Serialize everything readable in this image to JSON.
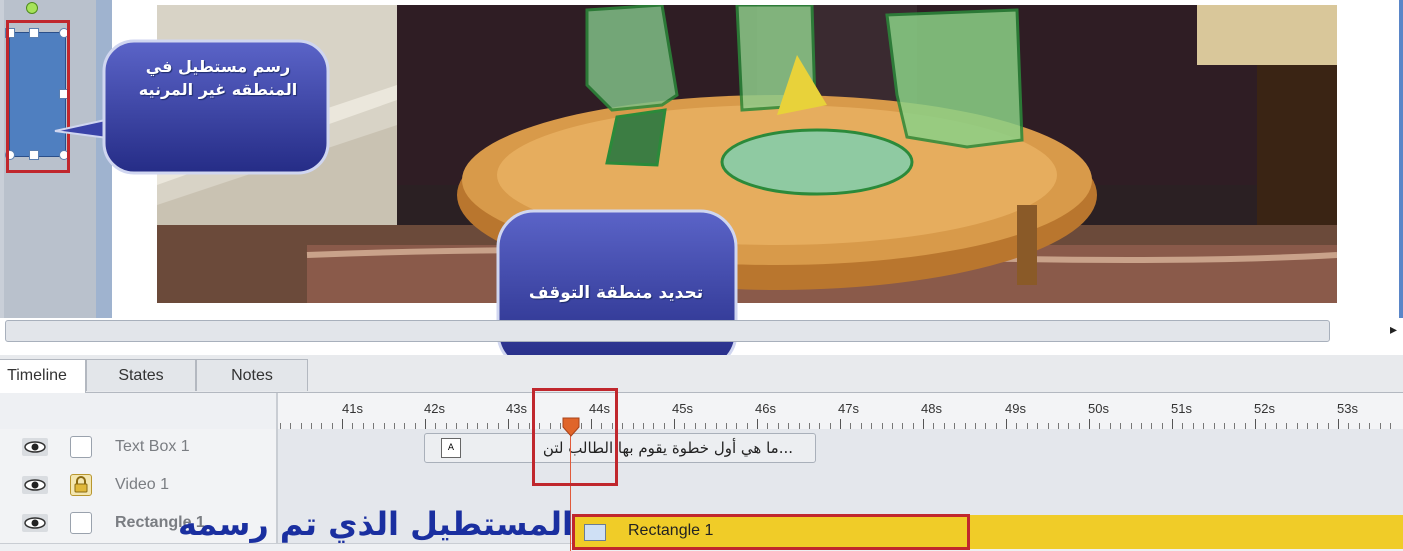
{
  "callouts": {
    "top": "رسم مستطيل في المنطقه غير المرنيه",
    "middle": "تحديد منطقة التوقف"
  },
  "caption": "المستطيل الذي تم رسمه",
  "tabs": [
    {
      "label": "Timeline",
      "active": true
    },
    {
      "label": "States",
      "active": false
    },
    {
      "label": "Notes",
      "active": false
    }
  ],
  "ruler": {
    "ticks": [
      "41s",
      "42s",
      "43s",
      "44s",
      "45s",
      "46s",
      "47s",
      "48s",
      "49s",
      "50s",
      "51s",
      "52s",
      "53s"
    ]
  },
  "tracks": [
    {
      "name": "Text Box 1",
      "visible": true,
      "locked": false,
      "item_text": "...ما هي أول خطوة يقوم بها الطالب لتن"
    },
    {
      "name": "Video 1",
      "visible": true,
      "locked": true
    },
    {
      "name": "Rectangle 1",
      "visible": true,
      "locked": false,
      "item_text": "Rectangle 1"
    }
  ],
  "playhead_time_s": 43.7,
  "colors": {
    "accent_blue": "#5a86c8",
    "highlight_red": "#c0272d",
    "rectangle_bar": "#f0cc28",
    "playhead": "#e0652a",
    "caption_blue": "#1a2fa0"
  },
  "icons": [
    "eye-icon",
    "lock-icon",
    "text-box-icon",
    "rectangle-icon",
    "playhead-marker-icon",
    "scroll-right-arrow-icon"
  ]
}
